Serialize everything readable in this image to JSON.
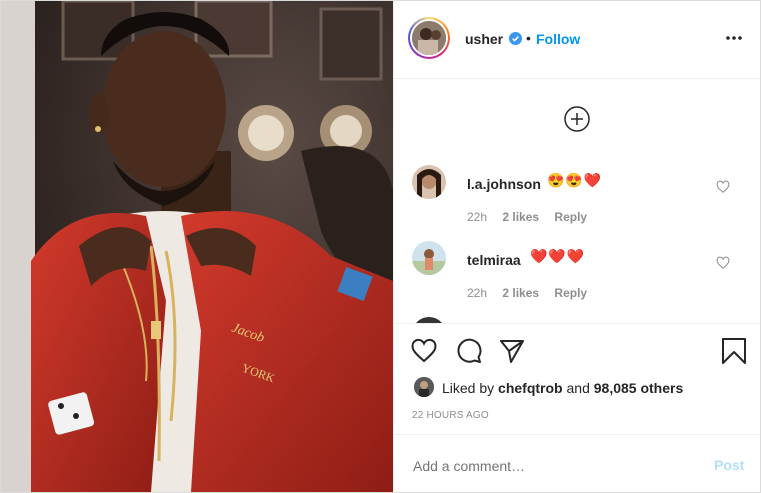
{
  "post": {
    "image_alt": "Man in red varsity jacket adjusting collar in front of a mirror",
    "header": {
      "username": "usher",
      "separator": "•",
      "follow_label": "Follow",
      "verified_icon": "verified-badge-icon",
      "more_icon": "more-options-icon"
    },
    "comments": [
      {
        "username": "l.a.johnson",
        "text": "😍😍❤️",
        "time": "22h",
        "likes": "2 likes",
        "reply_label": "Reply"
      },
      {
        "username": "telmiraa",
        "text": "❤️❤️❤️",
        "time": "22h",
        "likes": "2 likes",
        "reply_label": "Reply"
      }
    ],
    "actions": {
      "like_icon": "heart-icon",
      "comment_icon": "comment-icon",
      "share_icon": "share-icon",
      "save_icon": "bookmark-icon"
    },
    "liked_by": {
      "prefix": "Liked by",
      "user": "chefqtrob",
      "conjunction": "and",
      "others": "98,085 others"
    },
    "time_ago": "22 HOURS AGO",
    "add_comment": {
      "placeholder": "Add a comment…",
      "post_label": "Post"
    }
  },
  "colors": {
    "accent": "#0095f6",
    "muted": "#8e8e8e",
    "post_disabled": "#b2dffc",
    "border": "#efefef"
  }
}
